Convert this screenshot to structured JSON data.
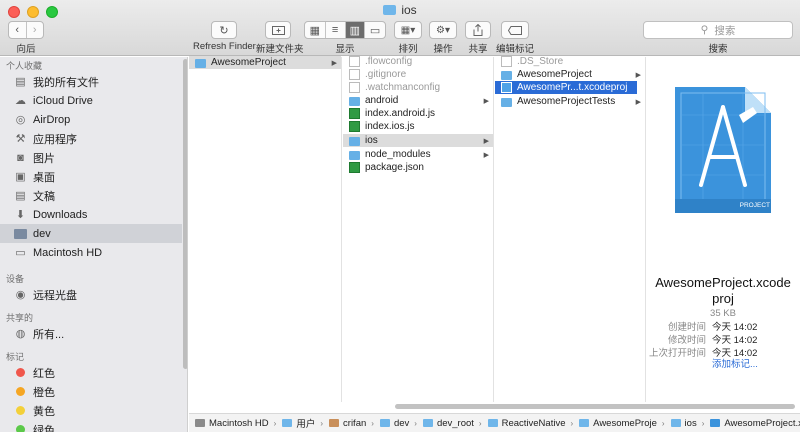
{
  "window": {
    "title": "ios"
  },
  "toolbar": {
    "back_label": "向后",
    "refresh_label": "Refresh Finder",
    "new_folder_label": "新建文件夹",
    "view_label": "显示",
    "arrange_label": "排列",
    "action_label": "操作",
    "share_label": "共享",
    "tags_label": "编辑标记",
    "search_placeholder": "搜索",
    "search_label": "搜索"
  },
  "sidebar": {
    "favorites_heading": "个人收藏",
    "favorites": [
      {
        "label": "我的所有文件",
        "icon": "all-files-icon"
      },
      {
        "label": "iCloud Drive",
        "icon": "cloud-icon"
      },
      {
        "label": "AirDrop",
        "icon": "airdrop-icon"
      },
      {
        "label": "应用程序",
        "icon": "applications-icon"
      },
      {
        "label": "图片",
        "icon": "camera-icon"
      },
      {
        "label": "桌面",
        "icon": "desktop-icon"
      },
      {
        "label": "文稿",
        "icon": "documents-icon"
      },
      {
        "label": "Downloads",
        "icon": "downloads-icon"
      },
      {
        "label": "dev",
        "icon": "folder-icon",
        "selected": true
      },
      {
        "label": "Macintosh HD",
        "icon": "disk-icon"
      }
    ],
    "devices_heading": "设备",
    "devices": [
      {
        "label": "远程光盘",
        "icon": "disc-icon"
      }
    ],
    "shared_heading": "共享的",
    "shared": [
      {
        "label": "所有...",
        "icon": "network-icon"
      }
    ],
    "tags_heading": "标记",
    "tags": [
      {
        "label": "红色",
        "color": "#f0574c"
      },
      {
        "label": "橙色",
        "color": "#f5a623"
      },
      {
        "label": "黄色",
        "color": "#f3d03a"
      },
      {
        "label": "绿色",
        "color": "#5cc94a"
      }
    ]
  },
  "columns": {
    "col1": [
      {
        "label": "AwesomeProject",
        "type": "folder",
        "chevron": true,
        "state": "grey"
      }
    ],
    "col2": [
      {
        "label": ".flowconfig",
        "type": "doc",
        "dim": true
      },
      {
        "label": ".gitignore",
        "type": "doc",
        "dim": true
      },
      {
        "label": ".watchmanconfig",
        "type": "doc",
        "dim": true
      },
      {
        "label": "android",
        "type": "folder",
        "chevron": true
      },
      {
        "label": "index.android.js",
        "type": "js"
      },
      {
        "label": "index.ios.js",
        "type": "js"
      },
      {
        "label": "ios",
        "type": "folder",
        "chevron": true,
        "state": "grey"
      },
      {
        "label": "node_modules",
        "type": "folder",
        "chevron": true
      },
      {
        "label": "package.json",
        "type": "js"
      }
    ],
    "col3": [
      {
        "label": ".DS_Store",
        "type": "doc",
        "dim": true
      },
      {
        "label": "AwesomeProject",
        "type": "folder",
        "chevron": true
      },
      {
        "label": "AwesomePr...t.xcodeproj",
        "type": "xproj",
        "chevron": true,
        "state": "blue"
      },
      {
        "label": "AwesomeProjectTests",
        "type": "folder",
        "chevron": true
      }
    ]
  },
  "preview": {
    "icon_badge": "PROJECT",
    "name_line1": "AwesomeProject.xcode",
    "name_line2": "proj",
    "size": "35 KB",
    "meta": [
      {
        "key": "创建时间",
        "value": "今天 14:02"
      },
      {
        "key": "修改时间",
        "value": "今天 14:02"
      },
      {
        "key": "上次打开时间",
        "value": "今天 14:02"
      }
    ],
    "more_tags": "添加标记..."
  },
  "pathbar": [
    "Macintosh HD",
    "用户",
    "crifan",
    "dev",
    "dev_root",
    "ReactiveNative",
    "AwesomeProje",
    "ios",
    "AwesomeProject.xcodeproj"
  ]
}
